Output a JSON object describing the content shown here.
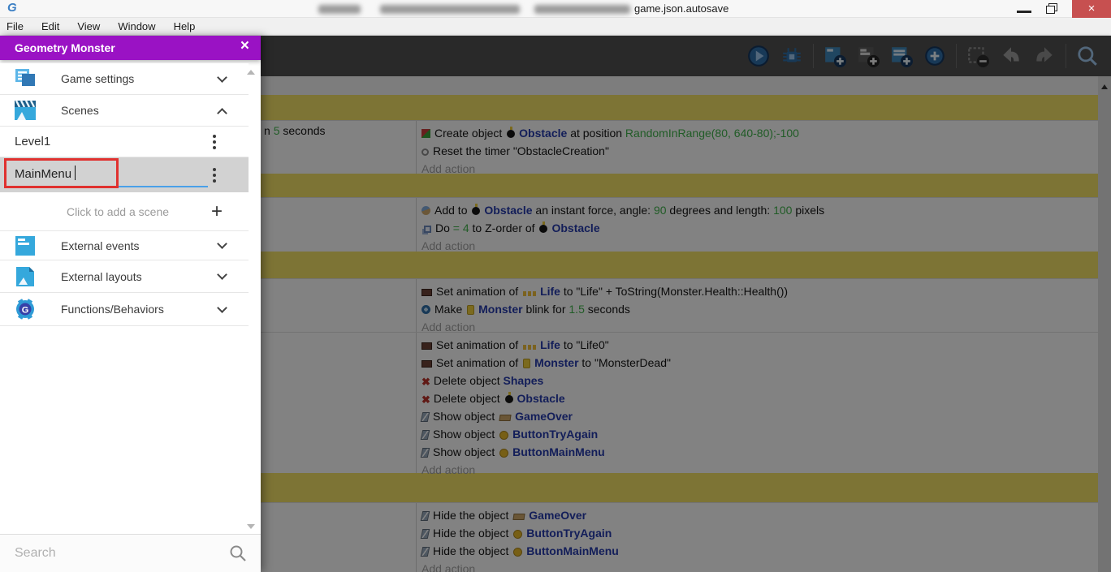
{
  "titlebar": {
    "title_tail": "game.json.autosave",
    "close": "×"
  },
  "menubar": {
    "items": {
      "file": "File",
      "edit": "Edit",
      "view": "View",
      "window": "Window",
      "help": "Help"
    }
  },
  "panel": {
    "title": "Geometry Monster",
    "close": "×",
    "game_settings": "Game settings",
    "scenes": "Scenes",
    "scene1": "Level1",
    "scene_edit_value": "MainMenu",
    "add_scene": "Click to add a scene",
    "external_events": "External events",
    "external_layouts": "External layouts",
    "functions": "Functions/Behaviors",
    "search_placeholder": "Search"
  },
  "glyphs": {
    "logo": "G",
    "delete": "✖",
    "plus": "+"
  },
  "events": {
    "e1": {
      "cond": {
        "pre": "n ",
        "num": "5",
        "post": " seconds"
      },
      "a1": {
        "pre": "Create object ",
        "obj": "Obstacle",
        "mid": " at position ",
        "val": "RandomInRange(80, 640-80);-100"
      },
      "a2": {
        "pre": "Reset the timer \"ObstacleCreation\""
      },
      "add": "Add action"
    },
    "e2": {
      "a1": {
        "pre": "Add to ",
        "obj": "Obstacle",
        "mid": " an instant force, angle: ",
        "val": "90",
        "mid2": " degrees and length: ",
        "val2": "100",
        "post": " pixels"
      },
      "a2": {
        "pre": "Do ",
        "val": "= 4",
        "mid": " to Z-order of ",
        "obj": "Obstacle"
      },
      "add": "Add action"
    },
    "e3": {
      "a1": {
        "pre": "Set animation of ",
        "obj": "Life",
        "mid": " to ",
        "post": "\"Life\" + ToString(Monster.Health::Health())"
      },
      "a2": {
        "pre": "Make ",
        "obj": "Monster",
        "mid": " blink for ",
        "val": "1.5",
        "post": " seconds"
      },
      "add": "Add action"
    },
    "e4": {
      "a1": {
        "pre": "Set animation of ",
        "obj": "Life",
        "mid": " to ",
        "post": "\"Life0\""
      },
      "a2": {
        "pre": "Set animation of ",
        "obj": "Monster",
        "mid": " to ",
        "post": "\"MonsterDead\""
      },
      "a3": {
        "pre": "Delete object ",
        "obj": "Shapes"
      },
      "a4": {
        "pre": "Delete object ",
        "obj": "Obstacle"
      },
      "a5": {
        "pre": "Show object ",
        "obj": "GameOver"
      },
      "a6": {
        "pre": "Show object ",
        "obj": "ButtonTryAgain"
      },
      "a7": {
        "pre": "Show object ",
        "obj": "ButtonMainMenu"
      },
      "add": "Add action"
    },
    "e5": {
      "a1": {
        "pre": "Hide the object ",
        "obj": "GameOver"
      },
      "a2": {
        "pre": "Hide the object ",
        "obj": "ButtonTryAgain"
      },
      "a3": {
        "pre": "Hide the object ",
        "obj": "ButtonMainMenu"
      },
      "add": "Add action"
    }
  },
  "colors": {
    "panel_purple": "#9a12c4",
    "object_blue": "#2439a8",
    "param_green": "#3fae4a",
    "comment_yellow": "#ecdb64",
    "close_red": "#c75050",
    "focus_blue": "#4aa0e8",
    "annotation_red": "#e0312f"
  }
}
